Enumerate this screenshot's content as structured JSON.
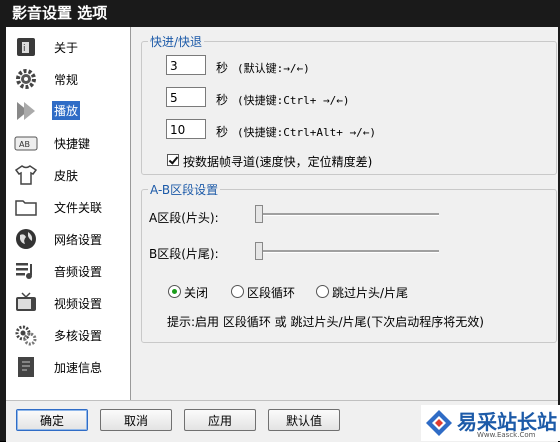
{
  "window": {
    "title": "影音设置 选项"
  },
  "sidebar": {
    "items": [
      {
        "label": "关于",
        "icon": "info-icon"
      },
      {
        "label": "常规",
        "icon": "gear-icon"
      },
      {
        "label": "播放",
        "icon": "play-icon"
      },
      {
        "label": "快捷键",
        "icon": "keyboard-ab-icon"
      },
      {
        "label": "皮肤",
        "icon": "tshirt-icon"
      },
      {
        "label": "文件关联",
        "icon": "folder-icon"
      },
      {
        "label": "网络设置",
        "icon": "globe-icon"
      },
      {
        "label": "音频设置",
        "icon": "audio-list-icon"
      },
      {
        "label": "视频设置",
        "icon": "tv-icon"
      },
      {
        "label": "多核设置",
        "icon": "cpu-gears-icon"
      },
      {
        "label": "加速信息",
        "icon": "accel-page-icon"
      }
    ],
    "active": "播放"
  },
  "seek": {
    "legend": "快进/快退",
    "rows": [
      {
        "value": "3",
        "unit": "秒",
        "hint": "(默认键:→/←)"
      },
      {
        "value": "5",
        "unit": "秒",
        "hint": "(快捷键:Ctrl+ →/←)"
      },
      {
        "value": "10",
        "unit": "秒",
        "hint": "(快捷键:Ctrl+Alt+ →/←)"
      }
    ],
    "keyframe_label": "按数据帧寻道(速度快，定位精度差)",
    "keyframe_checked": true
  },
  "ab": {
    "legend": "A-B区段设置",
    "a_label": "A区段(片头):",
    "b_label": "B区段(片尾):",
    "a_value": 0,
    "b_value": 0,
    "modes": [
      "关闭",
      "区段循环",
      "跳过片头/片尾"
    ],
    "selected_mode": "关闭",
    "tip": "提示:启用 区段循环 或 跳过片头/片尾(下次启动程序将无效)"
  },
  "buttons": {
    "ok": "确定",
    "cancel": "取消",
    "apply": "应用",
    "default": "默认值"
  },
  "watermark": {
    "text": "易采站长站",
    "sub": "Www.Easck.Com"
  },
  "colors": {
    "accent": "#2f6cc6",
    "legend": "#1c5aa8",
    "radio_dot": "#1a9c1a",
    "titlebar": "#1a1a1a"
  }
}
